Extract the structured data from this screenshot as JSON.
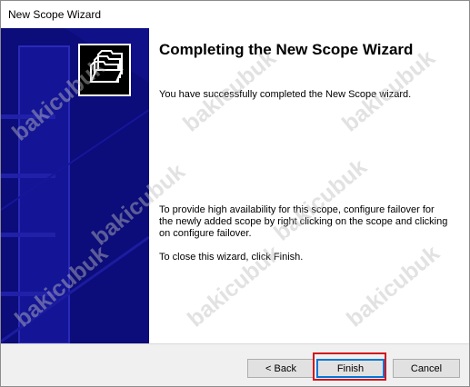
{
  "window": {
    "title": "New Scope Wizard"
  },
  "wizard": {
    "heading": "Completing the New Scope Wizard",
    "success_text": "You have successfully completed the New Scope wizard.",
    "failover_text": "To provide high availability for this scope, configure failover for the newly added scope by right clicking on the scope and clicking on configure failover.",
    "close_text": "To close this wizard, click Finish."
  },
  "buttons": {
    "back": "< Back",
    "finish": "Finish",
    "cancel": "Cancel"
  },
  "watermark": {
    "text": "bakicubuk"
  },
  "colors": {
    "sidebar": "#101088",
    "highlight": "#d2161d",
    "footer": "#f0f0f0"
  },
  "icons": {
    "sidebar_icon": "folder-stack-icon"
  }
}
